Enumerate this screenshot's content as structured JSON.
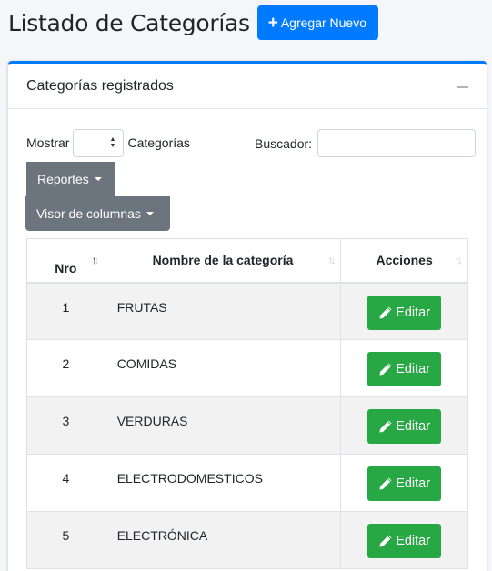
{
  "page": {
    "title": "Listado de Categorías",
    "add_button_label": "Agregar Nuevo"
  },
  "card": {
    "title": "Categorías registrados"
  },
  "controls": {
    "show_label": "Mostrar",
    "show_suffix": "Categorías",
    "search_label": "Buscador:",
    "search_value": "",
    "reports_button": "Reportes",
    "columns_button": "Visor de columnas"
  },
  "table": {
    "headers": [
      "Nro",
      "Nombre de la categoría",
      "Acciones"
    ],
    "rows": [
      {
        "nro": "1",
        "name": "FRUTAS",
        "action": "Editar"
      },
      {
        "nro": "2",
        "name": "COMIDAS",
        "action": "Editar"
      },
      {
        "nro": "3",
        "name": "VERDURAS",
        "action": "Editar"
      },
      {
        "nro": "4",
        "name": "ELECTRODOMESTICOS",
        "action": "Editar"
      },
      {
        "nro": "5",
        "name": "ELECTRÓNICA",
        "action": "Editar"
      }
    ]
  },
  "colors": {
    "primary": "#007bff",
    "success": "#28a745",
    "secondary": "#6c757d"
  },
  "icons": {
    "add": "plus-icon",
    "edit": "pencil-icon",
    "collapse": "minus-icon",
    "sort": "sort-arrows-icon"
  }
}
